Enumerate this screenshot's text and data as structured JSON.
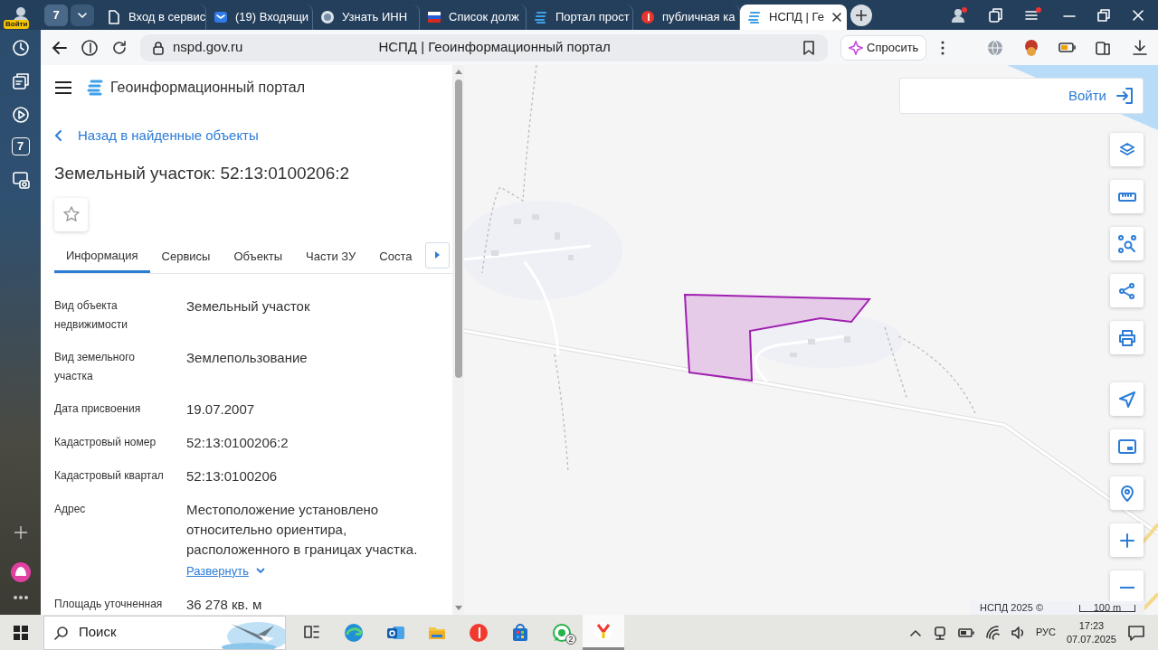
{
  "browser": {
    "profile_label": "Войти",
    "tab_count": "7",
    "tabs": [
      {
        "kind": "page",
        "title": "Вход в сервис",
        "selected": false
      },
      {
        "kind": "mail",
        "title": "(19) Входящи",
        "selected": false
      },
      {
        "kind": "emblem",
        "title": "Узнать ИНН",
        "selected": false
      },
      {
        "kind": "flag",
        "title": "Список долж",
        "selected": false
      },
      {
        "kind": "portal",
        "title": "Портал прост",
        "selected": false
      },
      {
        "kind": "yandex",
        "title": "публичная ка",
        "selected": false
      },
      {
        "kind": "portal",
        "title": "НСПД | Ге",
        "selected": true
      }
    ],
    "url": "nspd.gov.ru",
    "page_title": "НСПД | Геоинформационный портал",
    "ask_button": "Спросить"
  },
  "sidebar": {
    "counter": "7"
  },
  "panel": {
    "app_title": "Геоинформационный портал",
    "back_link": "Назад в найденные объекты",
    "heading": "Земельный участок: 52:13:0100206:2",
    "tabs": [
      {
        "label": "Информация",
        "selected": true
      },
      {
        "label": "Сервисы",
        "selected": false
      },
      {
        "label": "Объекты",
        "selected": false
      },
      {
        "label": "Части ЗУ",
        "selected": false
      },
      {
        "label": "Соста",
        "selected": false
      }
    ],
    "fields": [
      {
        "label": "Вид объекта недвижимости",
        "value": "Земельный участок"
      },
      {
        "label": "Вид земельного участка",
        "value": "Землепользование"
      },
      {
        "label": "Дата присвоения",
        "value": "19.07.2007"
      },
      {
        "label": "Кадастровый номер",
        "value": "52:13:0100206:2"
      },
      {
        "label": "Кадастровый квартал",
        "value": "52:13:0100206"
      },
      {
        "label": "Адрес",
        "value": "Местоположение установлено относительно ориентира, расположенного в границах участка.",
        "expand_link": "Развернуть"
      },
      {
        "label": "Площадь уточненная",
        "value": "36 278 кв. м"
      }
    ]
  },
  "map": {
    "kind": "picture",
    "login_button": "Войти",
    "attribution": "НСПД 2025 ©",
    "scale": "100 m"
  },
  "taskbar": {
    "search_placeholder": "Поиск",
    "apps": [
      {
        "kind": "task-view",
        "active": false
      },
      {
        "kind": "edge",
        "active": false
      },
      {
        "kind": "outlook",
        "active": false
      },
      {
        "kind": "explorer",
        "active": false
      },
      {
        "kind": "yandex",
        "active": false
      },
      {
        "kind": "store",
        "active": false
      },
      {
        "kind": "whatsapp",
        "badge": "2",
        "active": false
      },
      {
        "kind": "ybrowser",
        "active": true
      }
    ],
    "language": "РУС",
    "time": "17:23",
    "date": "07.07.2025"
  }
}
